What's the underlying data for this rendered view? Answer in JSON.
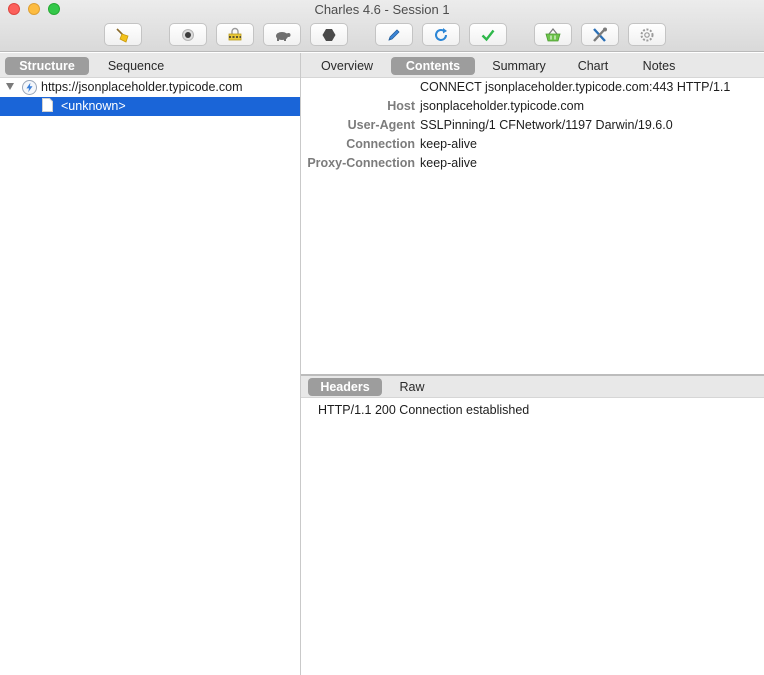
{
  "window": {
    "title": "Charles 4.6 - Session 1",
    "controls": [
      "close",
      "minimize",
      "zoom"
    ]
  },
  "toolbar": {
    "buttons": [
      {
        "icon": "broom-icon"
      },
      {
        "icon": "record-icon"
      },
      {
        "icon": "ssl-proxy-lock-icon"
      },
      {
        "icon": "throttle-turtle-icon"
      },
      {
        "icon": "breakpoints-hexagon-icon"
      },
      {
        "icon": "compose-pen-icon"
      },
      {
        "icon": "repeat-icon"
      },
      {
        "icon": "validate-check-icon"
      },
      {
        "icon": "shopping-basket-icon"
      },
      {
        "icon": "tools-icon"
      },
      {
        "icon": "settings-gear-icon"
      }
    ]
  },
  "left": {
    "tabs": [
      {
        "label": "Structure",
        "active": true
      },
      {
        "label": "Sequence",
        "active": false
      }
    ],
    "tree": [
      {
        "label": "https://jsonplaceholder.typicode.com",
        "icon": "bolt-icon",
        "expanded": true
      },
      {
        "label": "<unknown>",
        "icon": "document-icon",
        "selected": true
      }
    ]
  },
  "right": {
    "tabs": [
      {
        "label": "Overview",
        "active": false
      },
      {
        "label": "Contents",
        "active": true
      },
      {
        "label": "Summary",
        "active": false
      },
      {
        "label": "Chart",
        "active": false
      },
      {
        "label": "Notes",
        "active": false
      }
    ],
    "request": {
      "request_line": "CONNECT jsonplaceholder.typicode.com:443 HTTP/1.1",
      "headers": [
        {
          "name": "Host",
          "value": "jsonplaceholder.typicode.com"
        },
        {
          "name": "User-Agent",
          "value": "SSLPinning/1 CFNetwork/1197 Darwin/19.6.0"
        },
        {
          "name": "Connection",
          "value": "keep-alive"
        },
        {
          "name": "Proxy-Connection",
          "value": "keep-alive"
        }
      ]
    },
    "response_tabs": [
      {
        "label": "Headers",
        "active": true
      },
      {
        "label": "Raw",
        "active": false
      }
    ],
    "response": {
      "status_line": "HTTP/1.1 200 Connection established"
    }
  },
  "colors": {
    "selection": "#1a65d8",
    "active_segment": "#9d9d9d",
    "header_name": "#7c7c7c"
  }
}
